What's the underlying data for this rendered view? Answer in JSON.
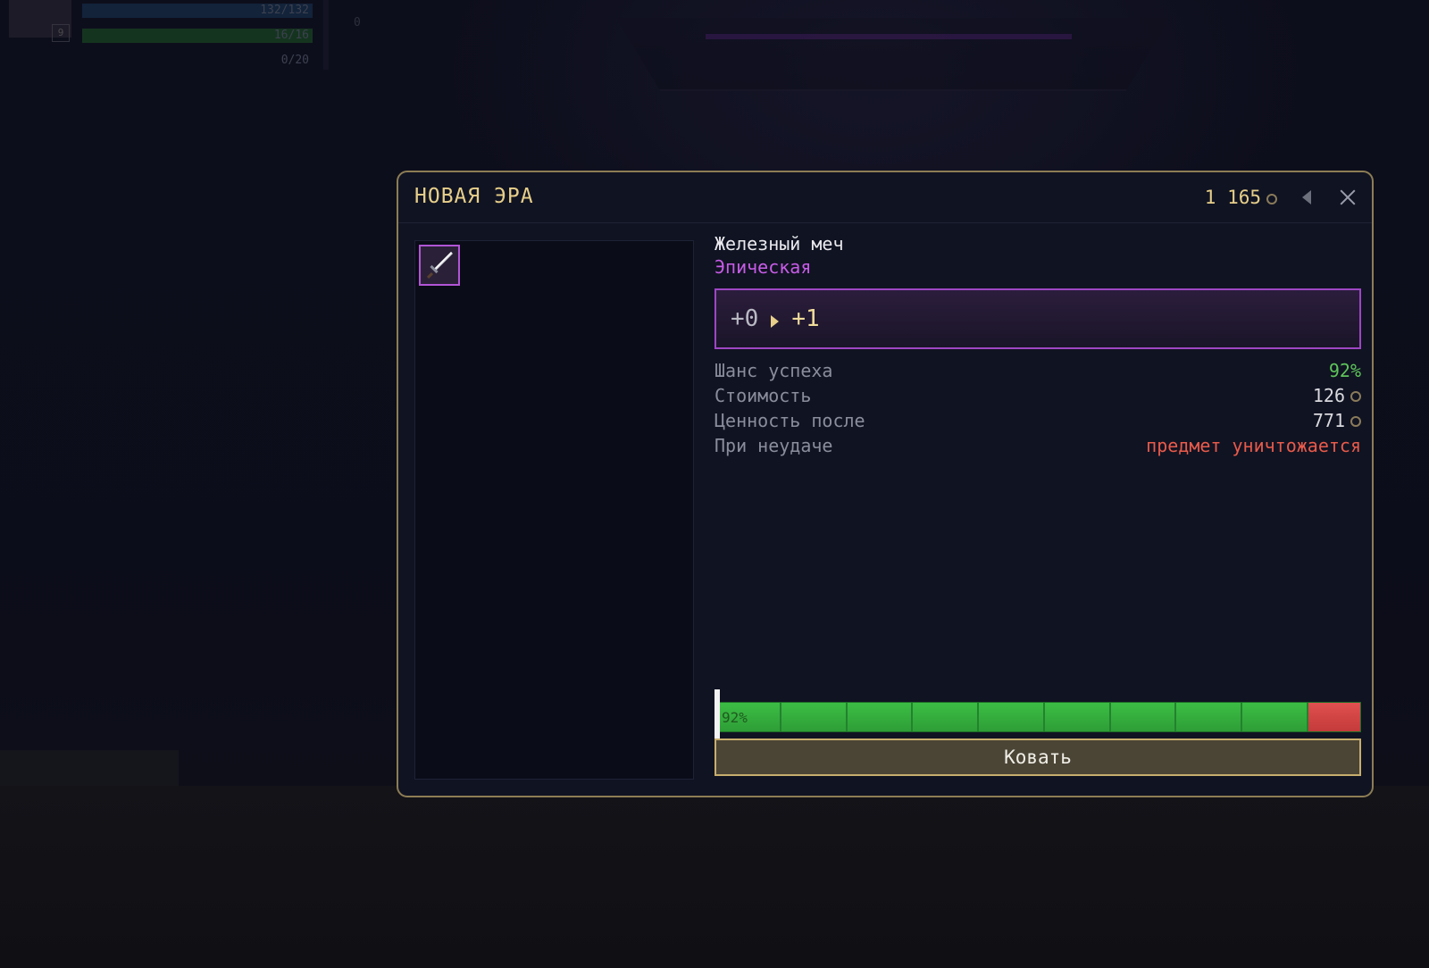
{
  "hud": {
    "hp_text": "132/132",
    "mp_text": "16/16",
    "xp_text": "0/20",
    "level": "9",
    "counter": "0"
  },
  "dialog": {
    "title": "НОВАЯ ЭРА",
    "balance": "1 165",
    "item": {
      "name": "Железный меч",
      "rarity": "Эпическая",
      "icon": "iron-sword-icon"
    },
    "upgrade": {
      "from": "+0",
      "to": "+1"
    },
    "stats": [
      {
        "label": "Шанс успеха",
        "value": "92%",
        "tone": "green",
        "coin": false
      },
      {
        "label": "Стоимость",
        "value": "126",
        "tone": "normal",
        "coin": true
      },
      {
        "label": "Ценность после",
        "value": "771",
        "tone": "normal",
        "coin": true
      },
      {
        "label": "При неудаче",
        "value": "предмет уничтожается",
        "tone": "red",
        "coin": false
      }
    ],
    "chance_bar": {
      "label": "92%",
      "success_fraction": 0.92
    },
    "forge_button": "Ковать"
  },
  "colors": {
    "accent_gold": "#e7cf8a",
    "rarity_epic": "#c85ce8",
    "success": "#5ec45a",
    "danger": "#e85a4a"
  }
}
